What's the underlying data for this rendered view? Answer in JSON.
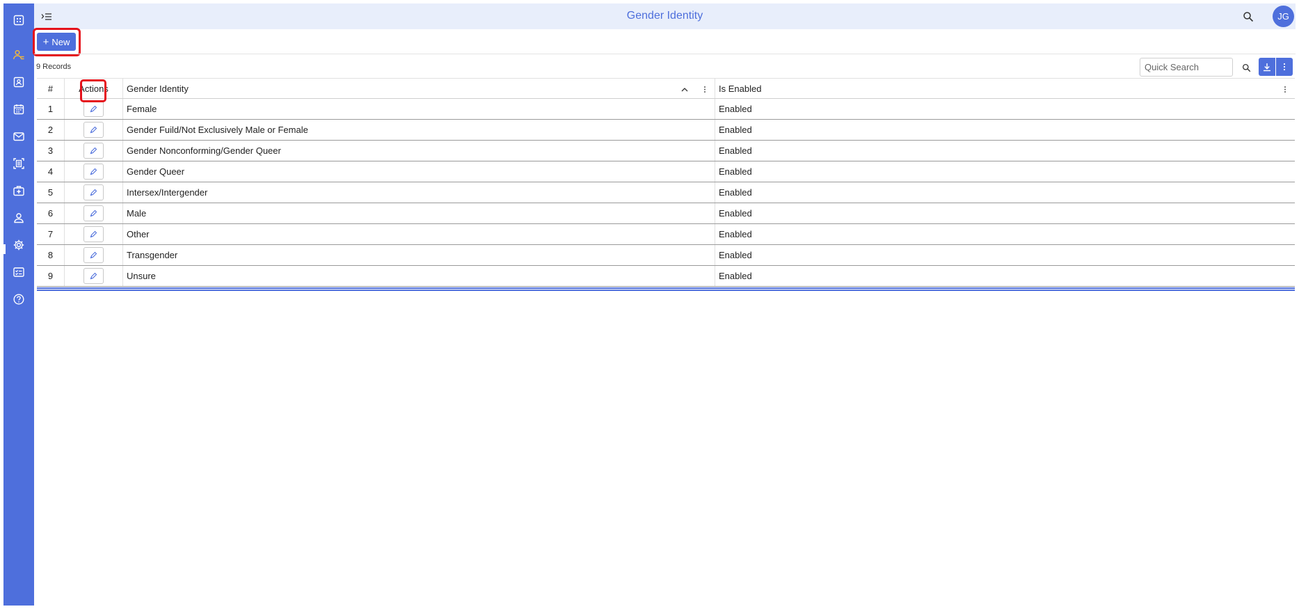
{
  "header": {
    "title": "Gender Identity",
    "avatar_initials": "JG"
  },
  "toolbar": {
    "new_label": "New"
  },
  "records": {
    "count_label": "9 Records"
  },
  "search": {
    "placeholder": "Quick Search"
  },
  "grid": {
    "columns": [
      "#",
      "Actions",
      "Gender Identity",
      "Is Enabled"
    ],
    "rows": [
      {
        "num": "1",
        "gender_identity": "Female",
        "is_enabled": "Enabled"
      },
      {
        "num": "2",
        "gender_identity": "Gender Fuild/Not Exclusively Male or Female",
        "is_enabled": "Enabled"
      },
      {
        "num": "3",
        "gender_identity": "Gender Nonconforming/Gender Queer",
        "is_enabled": "Enabled"
      },
      {
        "num": "4",
        "gender_identity": "Gender Queer",
        "is_enabled": "Enabled"
      },
      {
        "num": "5",
        "gender_identity": "Intersex/Intergender",
        "is_enabled": "Enabled"
      },
      {
        "num": "6",
        "gender_identity": "Male",
        "is_enabled": "Enabled"
      },
      {
        "num": "7",
        "gender_identity": "Other",
        "is_enabled": "Enabled"
      },
      {
        "num": "8",
        "gender_identity": "Transgender",
        "is_enabled": "Enabled"
      },
      {
        "num": "9",
        "gender_identity": "Unsure",
        "is_enabled": "Enabled"
      }
    ]
  },
  "sidebar": {
    "icons": [
      "apps-grid-icon",
      "user-list-icon",
      "contact-card-icon",
      "calendar-icon",
      "mail-icon",
      "scan-document-icon",
      "medical-kit-icon",
      "person-icon",
      "gear-icon",
      "checklist-icon",
      "help-icon"
    ],
    "active_icon": "user-list-icon"
  },
  "colors": {
    "brand": "#4e6fdc",
    "active_icon": "#f5b938",
    "header_bg": "#e8eefb",
    "highlight": "#e5121b"
  }
}
